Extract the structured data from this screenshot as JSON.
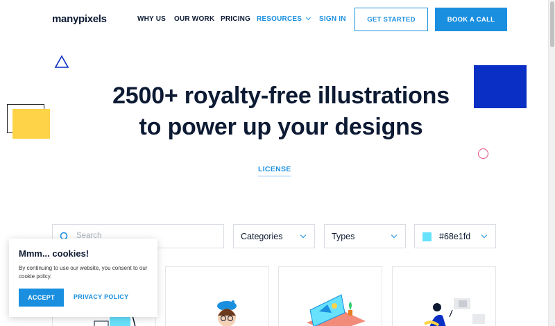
{
  "header": {
    "logo": "manypixels",
    "nav": [
      "WHY US",
      "OUR WORK",
      "PRICING",
      "RESOURCES",
      "SIGN IN"
    ],
    "get_started": "GET STARTED",
    "book_call": "BOOK A CALL"
  },
  "hero": {
    "title_line1": "2500+ royalty-free illustrations",
    "title_line2": "to power up your designs",
    "license": "LICENSE"
  },
  "filters": {
    "search_placeholder": "Search",
    "categories": "Categories",
    "types": "Types",
    "color_value": "#68e1fd"
  },
  "cookie": {
    "title": "Mmm... cookies!",
    "text": "By continuing to use our website, you consent to our cookie policy.",
    "accept": "ACCEPT",
    "privacy": "PRIVACY POLICY"
  },
  "colors": {
    "accent": "#1a8fe0",
    "dark": "#0d1a33",
    "deco_blue": "#0a2fc5",
    "deco_yellow": "#ffd348",
    "deco_pink": "#e14b7a",
    "swatch": "#68e1fd"
  }
}
